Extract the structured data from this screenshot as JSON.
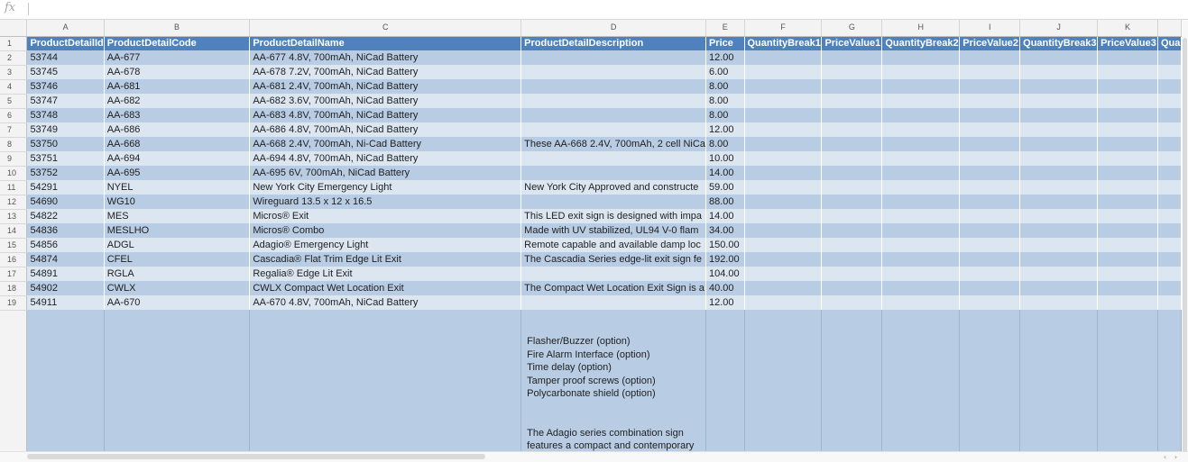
{
  "formula_bar": {
    "fx_label": "fx",
    "value": ""
  },
  "column_letters": [
    "",
    "A",
    "B",
    "C",
    "D",
    "E",
    "F",
    "G",
    "H",
    "I",
    "J",
    "K",
    ""
  ],
  "row_numbers": [
    "1",
    "2",
    "3",
    "4",
    "5",
    "6",
    "7",
    "8",
    "9",
    "10",
    "11",
    "12",
    "13",
    "14",
    "15",
    "16",
    "17",
    "18",
    "19",
    ""
  ],
  "header_row": [
    "ProductDetailId",
    "ProductDetailCode",
    "ProductDetailName",
    "ProductDetailDescription",
    "Price",
    "QuantityBreak1",
    "PriceValue1",
    "QuantityBreak2",
    "PriceValue2",
    "QuantityBreak3",
    "PriceValue3",
    "Qua"
  ],
  "rows": [
    [
      "53744",
      "AA-677",
      "AA-677 4.8V, 700mAh, NiCad Battery",
      "",
      "12.00"
    ],
    [
      "53745",
      "AA-678",
      "AA-678 7.2V, 700mAh, NiCad Battery",
      "",
      "6.00"
    ],
    [
      "53746",
      "AA-681",
      "AA-681 2.4V, 700mAh, NiCad Battery",
      "",
      "8.00"
    ],
    [
      "53747",
      "AA-682",
      "AA-682 3.6V, 700mAh, NiCad Battery",
      "",
      "8.00"
    ],
    [
      "53748",
      "AA-683",
      "AA-683 4.8V, 700mAh, NiCad Battery",
      "",
      "8.00"
    ],
    [
      "53749",
      "AA-686",
      "AA-686 4.8V, 700mAh, NiCad Battery",
      "",
      "12.00"
    ],
    [
      "53750",
      "AA-668",
      "AA-668 2.4V, 700mAh, Ni-Cad Battery",
      "These AA-668 2.4V, 700mAh, 2 cell NiCa",
      "8.00"
    ],
    [
      "53751",
      "AA-694",
      "AA-694 4.8V, 700mAh, NiCad Battery",
      "",
      "10.00"
    ],
    [
      "53752",
      "AA-695",
      "AA-695 6V, 700mAh, NiCad Battery",
      "",
      "14.00"
    ],
    [
      "54291",
      "NYEL",
      "New York City Emergency Light",
      "New York City Approved and constructe",
      "59.00"
    ],
    [
      "54690",
      "WG10",
      "Wireguard 13.5 x 12 x 16.5",
      "",
      "88.00"
    ],
    [
      "54822",
      "MES",
      "Micros® Exit",
      "This LED exit sign is designed with impa",
      "14.00"
    ],
    [
      "54836",
      "MESLHO",
      "Micros® Combo",
      "Made with UV stabilized, UL94 V-0 flam",
      "34.00"
    ],
    [
      "54856",
      "ADGL",
      "Adagio® Emergency Light",
      "Remote capable and available damp loc",
      "150.00"
    ],
    [
      "54874",
      "CFEL",
      "Cascadia® Flat Trim Edge Lit Exit",
      "The Cascadia Series edge-lit exit sign fe",
      "192.00"
    ],
    [
      "54891",
      "RGLA",
      "Regalia® Edge Lit Exit",
      "",
      "104.00"
    ],
    [
      "54902",
      "CWLX",
      "CWLX Compact Wet Location Exit",
      "The Compact Wet Location Exit Sign is a",
      "40.00"
    ],
    [
      "54911",
      "AA-670",
      "AA-670 4.8V, 700mAh, NiCad Battery",
      "",
      "12.00"
    ]
  ],
  "tall_cell_lines": [
    "Flasher/Buzzer (option)",
    "Fire Alarm Interface (option)",
    "Time delay (option)",
    "Tamper proof screws (option)",
    "Polycarbonate shield (option)",
    "",
    "",
    "The Adagio series combination sign",
    "features a compact and contemporary"
  ],
  "scroll": {
    "left_arrow": "‹",
    "right_arrow": "›"
  },
  "colors": {
    "header_fill": "#4f81bd",
    "band_dark": "#b8cce4",
    "band_light": "#dce6f1"
  }
}
